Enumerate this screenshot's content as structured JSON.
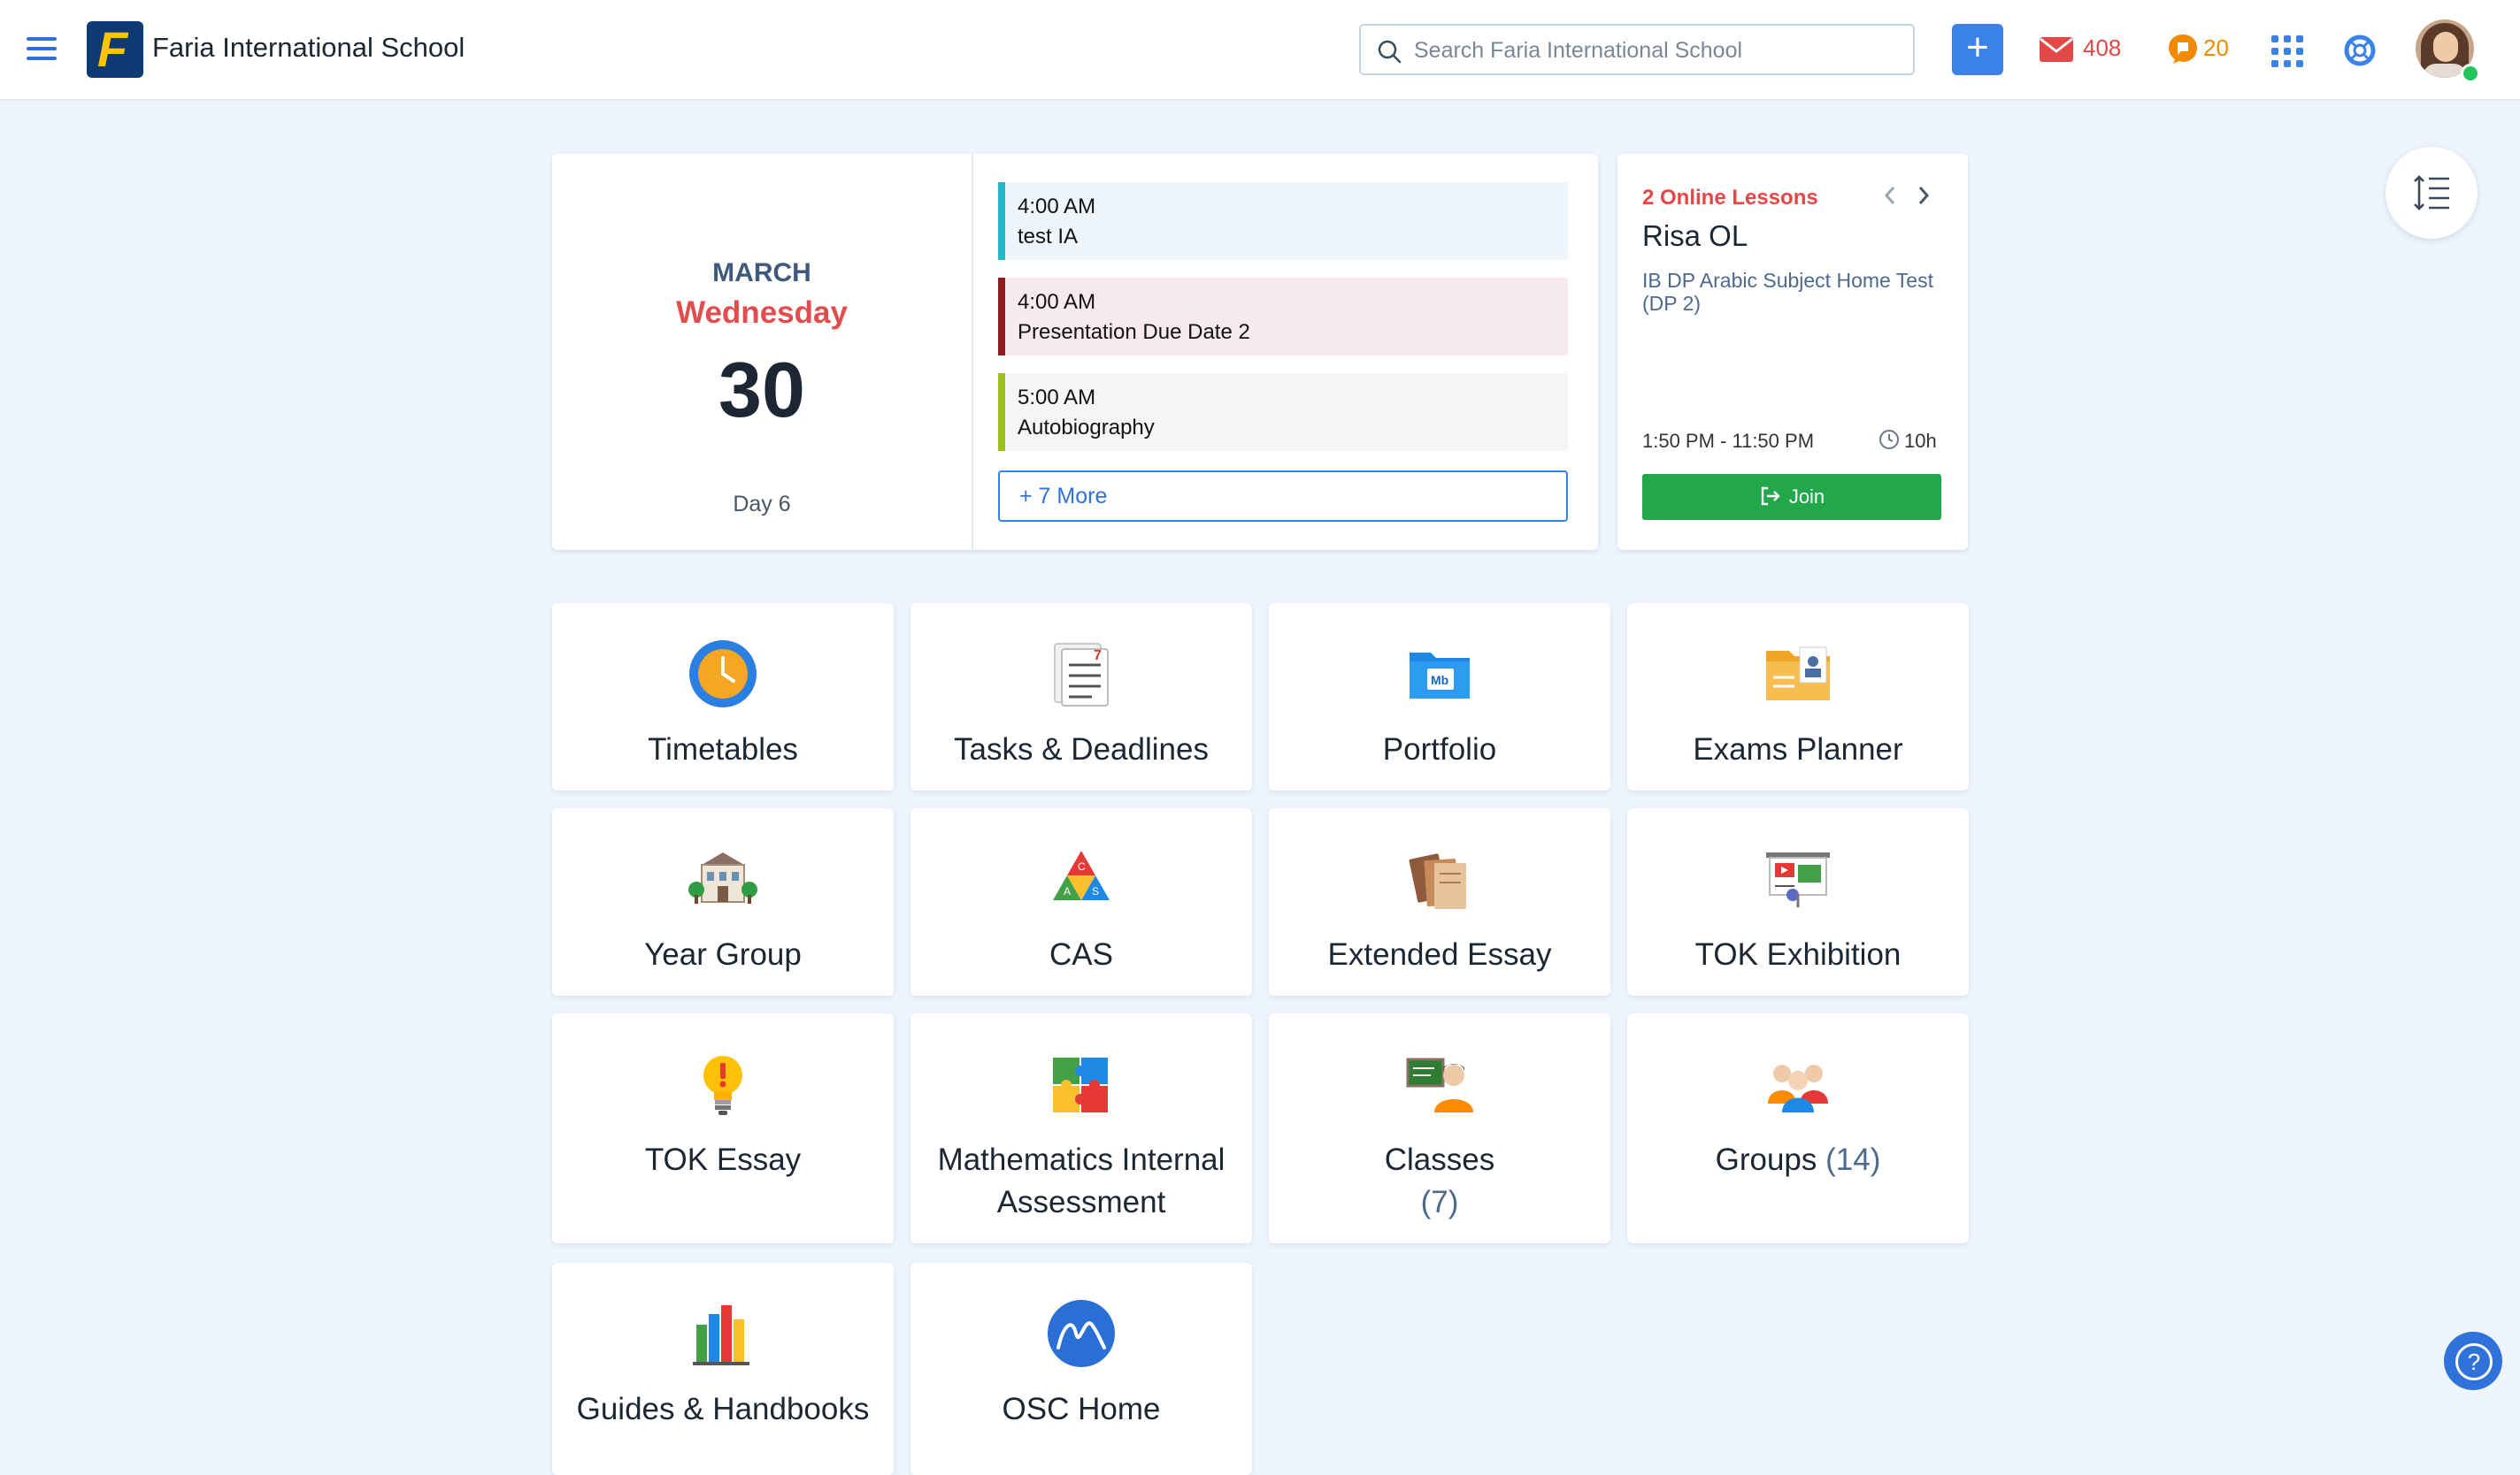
{
  "header": {
    "school_name": "Faria International School",
    "search_placeholder": "Search Faria International School",
    "add_label": "+",
    "mail_count": "408",
    "messages_count": "20",
    "colors": {
      "accent": "#3b82e8",
      "mail": "#e34848",
      "messages": "#f08a00"
    }
  },
  "date_panel": {
    "month": "MARCH",
    "weekday": "Wednesday",
    "day": "30",
    "cycle_day": "Day 6"
  },
  "events": [
    {
      "time": "4:00 AM",
      "title": "test IA",
      "bar_color": "#22b8c8",
      "bg": "#eef6fc"
    },
    {
      "time": "4:00 AM",
      "title": "Presentation Due Date 2",
      "bar_color": "#8f1d1d",
      "bg": "#f7eaee"
    },
    {
      "time": "5:00 AM",
      "title": "Autobiography",
      "bar_color": "#9bc11a",
      "bg": "#f3f6f2"
    }
  ],
  "more_events_label": "+ 7 More",
  "online_lessons": {
    "count_label": "2 Online Lessons",
    "teacher": "Risa OL",
    "subject": "IB DP Arabic Subject Home Test (DP 2)",
    "time_range": "1:50 PM - 11:50 PM",
    "duration": "10h",
    "join_label": "Join"
  },
  "tiles": [
    {
      "label": "Timetables",
      "icon": "clock-icon"
    },
    {
      "label": "Tasks & Deadlines",
      "icon": "checklist-icon"
    },
    {
      "label": "Portfolio",
      "icon": "portfolio-folder-icon"
    },
    {
      "label": "Exams Planner",
      "icon": "exam-folder-icon"
    },
    {
      "label": "Year Group",
      "icon": "school-building-icon"
    },
    {
      "label": "CAS",
      "icon": "cas-triangle-icon"
    },
    {
      "label": "Extended Essay",
      "icon": "books-icon"
    },
    {
      "label": "TOK Exhibition",
      "icon": "presentation-board-icon"
    },
    {
      "label": "TOK Essay",
      "icon": "lightbulb-icon"
    },
    {
      "label": "Mathematics Internal Assessment",
      "icon": "puzzle-icon"
    },
    {
      "label": "Classes",
      "count": "(7)",
      "icon": "teacher-board-icon"
    },
    {
      "label": "Groups",
      "count": "(14)",
      "icon": "people-group-icon"
    },
    {
      "label": "Guides & Handbooks",
      "icon": "handbooks-icon"
    },
    {
      "label": "OSC Home",
      "icon": "osc-logo-icon"
    }
  ],
  "help_label": "?"
}
